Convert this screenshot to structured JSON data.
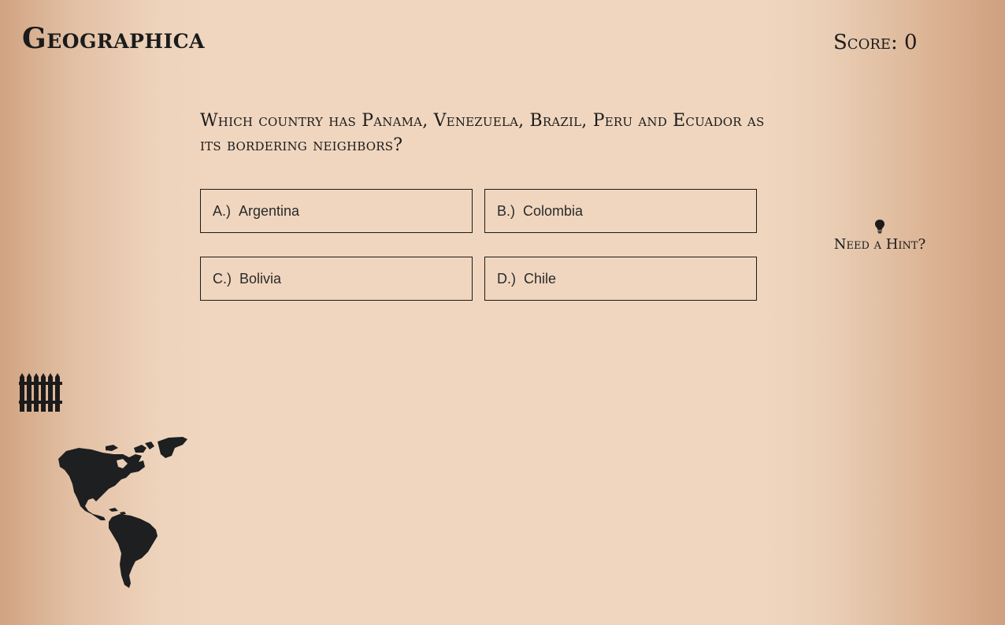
{
  "app": {
    "title": "Geographica"
  },
  "score": {
    "text": "Score: 0"
  },
  "question": {
    "text": "Which country has Panama, Venezuela, Brazil, Peru and Ecuador as its bordering neighbors?"
  },
  "answers": [
    {
      "letter": "A.)",
      "label": "Argentina"
    },
    {
      "letter": "B.)",
      "label": "Colombia"
    },
    {
      "letter": "C.)",
      "label": "Bolivia"
    },
    {
      "letter": "D.)",
      "label": "Chile"
    }
  ],
  "hint": {
    "label": "Need a Hint?",
    "icon": "lightbulb-icon"
  },
  "icons": {
    "fence": "fence-icon",
    "map": "americas-map-icon"
  },
  "colors": {
    "ink": "#1b1b1b",
    "background": "#f0d6bf",
    "edge": "#cfa07f"
  }
}
